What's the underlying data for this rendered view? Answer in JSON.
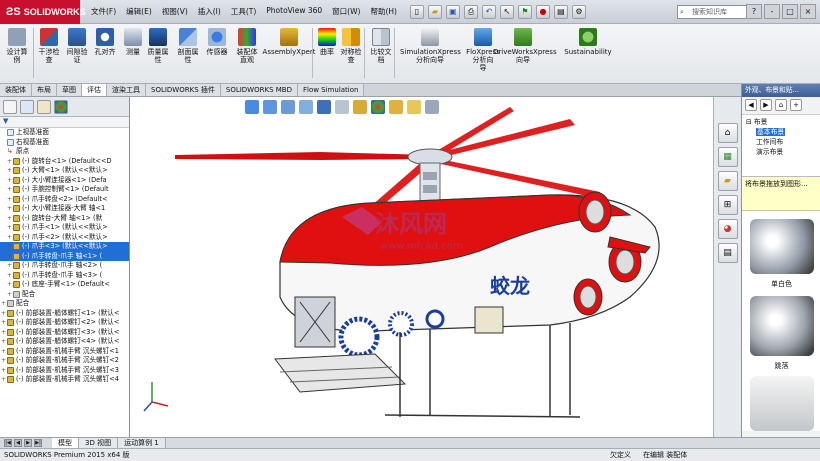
{
  "app": {
    "brand": "SOLIDWORKS",
    "menus": [
      "文件(F)",
      "编辑(E)",
      "视图(V)",
      "插入(I)",
      "工具(T)",
      "PhotoView 360",
      "窗口(W)",
      "帮助(H)"
    ],
    "search_placeholder": "搜索知识库",
    "window_controls": [
      "?",
      "-",
      "□",
      "×"
    ]
  },
  "command_manager": {
    "items": [
      {
        "label": "设计算\n例"
      },
      {
        "label": "干涉检\n查"
      },
      {
        "label": "间隙验\n证"
      },
      {
        "label": "孔对齐"
      },
      {
        "label": "测量"
      },
      {
        "label": "质量属\n性"
      },
      {
        "label": "剖面属\n性"
      },
      {
        "label": "传感器"
      },
      {
        "label": "装配体\n直观"
      },
      {
        "label": "AssemblyXpert"
      },
      {
        "label": "曲率"
      },
      {
        "label": "对称检\n查"
      },
      {
        "label": "比较文\n档"
      },
      {
        "label": "SimulationXpress\n分析向导"
      },
      {
        "label": "FloXpress\n分析向\n导"
      },
      {
        "label": "DriveWorksXpress\n向导"
      },
      {
        "label": "Sustainability"
      }
    ]
  },
  "tabs": [
    "装配体",
    "布局",
    "草图",
    "评估",
    "渲染工具",
    "SOLIDWORKS 插件",
    "SOLIDWORKS MBD",
    "Flow Simulation"
  ],
  "active_tab_index": 3,
  "feature_tree": {
    "filter_icon": "funnel-icon",
    "items": [
      {
        "text": "上视基准面",
        "kind": "plane",
        "expand": ""
      },
      {
        "text": "右视基准面",
        "kind": "plane",
        "expand": ""
      },
      {
        "text": "原点",
        "kind": "origin",
        "expand": ""
      },
      {
        "text": "(-) 旋转台<1> (Default<<D",
        "kind": "part",
        "expand": "+"
      },
      {
        "text": "(-) 大臂<1> (默认<<默认>",
        "kind": "part",
        "expand": "+"
      },
      {
        "text": "(-) 大小臂连接器<1> (Defa",
        "kind": "part",
        "expand": "+"
      },
      {
        "text": "(-) 手腕控制臂<1> (Default",
        "kind": "part",
        "expand": "+"
      },
      {
        "text": "(-) 爪手转盘<2> (Default<",
        "kind": "part",
        "expand": "+"
      },
      {
        "text": "(-) 大小臂连接器-大臂 轴<1",
        "kind": "part",
        "expand": "+"
      },
      {
        "text": "(-) 旋转台-大臂 轴<1> (默",
        "kind": "part",
        "expand": "+"
      },
      {
        "text": "(-) 爪手<1> (默认<<默认>",
        "kind": "part",
        "expand": "+"
      },
      {
        "text": "(-) 爪手<2> (默认<<默认>",
        "kind": "part",
        "expand": "+"
      },
      {
        "text": "(-) 爪手<3> (默认<<默认>",
        "kind": "part",
        "expand": "+",
        "selected": true
      },
      {
        "text": "(-) 爪手转盘-爪手 轴<1> (",
        "kind": "part",
        "expand": "+",
        "selected": true
      },
      {
        "text": "(-) 爪手转盘-爪手 轴<2> (",
        "kind": "part",
        "expand": "+"
      },
      {
        "text": "(-) 爪手转盘-爪手 轴<3> (",
        "kind": "part",
        "expand": "+"
      },
      {
        "text": "(-) 底座-手臂<1> (Default<",
        "kind": "part",
        "expand": "+"
      },
      {
        "text": "配合",
        "kind": "mate",
        "expand": "+"
      },
      {
        "text": "配合",
        "kind": "mate",
        "expand": "+",
        "root": true
      },
      {
        "text": "(-) 前部装置-艏体螺钉<1> (默认<",
        "kind": "part",
        "expand": "+",
        "root": true
      },
      {
        "text": "(-) 前部装置-艏体螺钉<2> (默认<",
        "kind": "part",
        "expand": "+",
        "root": true
      },
      {
        "text": "(-) 前部装置-艏体螺钉<3> (默认<",
        "kind": "part",
        "expand": "+",
        "root": true
      },
      {
        "text": "(-) 前部装置-艏体螺钉<4> (默认<",
        "kind": "part",
        "expand": "+",
        "root": true
      },
      {
        "text": "(-) 前部装置-机械手臂 沉头螺钉<1",
        "kind": "part",
        "expand": "+",
        "root": true
      },
      {
        "text": "(-) 前部装置-机械手臂 沉头螺钉<2",
        "kind": "part",
        "expand": "+",
        "root": true
      },
      {
        "text": "(-) 前部装置-机械手臂 沉头螺钉<3",
        "kind": "part",
        "expand": "+",
        "root": true
      },
      {
        "text": "(-) 前部装置-机械手臂 沉头螺钉<4",
        "kind": "part",
        "expand": "+",
        "root": true
      }
    ]
  },
  "bottom_tabs": [
    "模型",
    "3D 视图",
    "运动算例 1"
  ],
  "status": {
    "version": "SOLIDWORKS Premium 2015 x64 版",
    "defined": "欠定义",
    "editing": "在编辑 装配体"
  },
  "viewport": {
    "model_name_text": "蛟龙",
    "watermark_main": "沐风网",
    "watermark_url": "www.mfcad.com"
  },
  "task_pane": {
    "title": "外观、布景和贴...",
    "tree": [
      {
        "text": "布景",
        "level": 0
      },
      {
        "text": "基本布景",
        "level": 1,
        "selected": true
      },
      {
        "text": "工作间布",
        "level": 1
      },
      {
        "text": "演示布景",
        "level": 1
      }
    ],
    "tip": "将布景拖放到图形...",
    "swatch_labels": [
      "单白色",
      "跳落"
    ]
  },
  "colors": {
    "accent": "#1f6fd6",
    "brand_red": "#c8102e",
    "hull_red": "#e01010"
  }
}
